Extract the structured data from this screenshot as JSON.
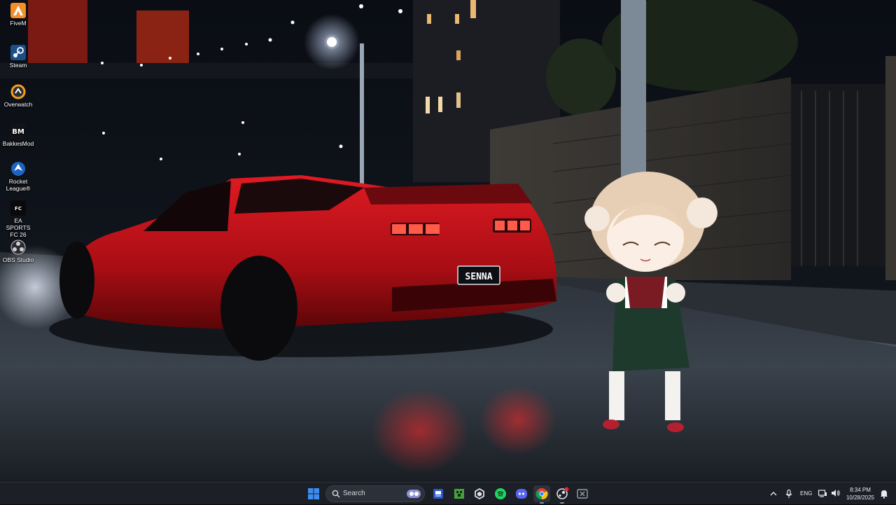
{
  "desktop": {
    "icons": [
      {
        "label": "FiveM",
        "icon": "fivem-icon"
      },
      {
        "label": "Steam",
        "icon": "steam-icon"
      },
      {
        "label": "Overwatch",
        "icon": "overwatch-icon"
      },
      {
        "label": "BakkesMod",
        "icon": "bakkesmod-icon"
      },
      {
        "label": "Rocket League®",
        "icon": "rocket-league-icon"
      },
      {
        "label": "EA SPORTS FC 26",
        "icon": "ea-sports-fc-icon"
      },
      {
        "label": "OBS Studio",
        "icon": "obs-studio-icon"
      }
    ],
    "wallpaper": {
      "license_plate": "SENNA",
      "car_color": "#c4141b",
      "description_icons": [
        "street-lamp",
        "car",
        "anime-character"
      ]
    }
  },
  "taskbar": {
    "search_label": "Search",
    "apps": [
      {
        "name": "start",
        "icon": "windows-start-icon"
      },
      {
        "name": "file-explorer",
        "icon": "folder-icon"
      },
      {
        "name": "minecraft",
        "icon": "minecraft-icon"
      },
      {
        "name": "app-hexagon",
        "icon": "hexagon-app-icon"
      },
      {
        "name": "spotify",
        "icon": "spotify-icon"
      },
      {
        "name": "discord",
        "icon": "discord-icon"
      },
      {
        "name": "chrome",
        "icon": "chrome-icon"
      },
      {
        "name": "steam-running",
        "icon": "steam-notification-icon"
      },
      {
        "name": "game-app",
        "icon": "xbox-app-icon"
      }
    ],
    "tray": {
      "language": "ENG",
      "time": "8:34 PM",
      "date": "10/28/2025"
    },
    "colors": {
      "taskbar_bg": "#1c1f26",
      "accent_blue": "#3b8ef0"
    }
  }
}
